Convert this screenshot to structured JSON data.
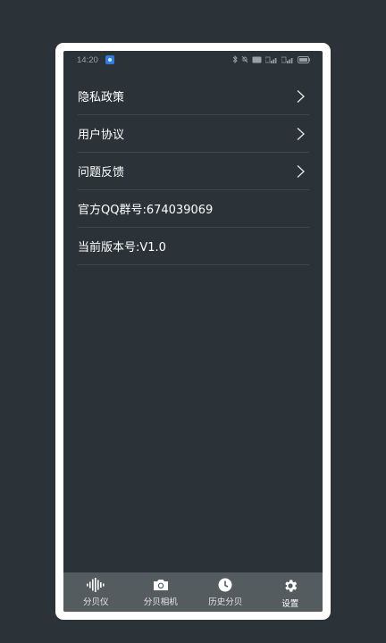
{
  "status_bar": {
    "time": "14:20"
  },
  "menu": {
    "items": [
      {
        "label": "隐私政策",
        "has_arrow": true
      },
      {
        "label": "用户协议",
        "has_arrow": true
      },
      {
        "label": "问题反馈",
        "has_arrow": true
      },
      {
        "label": "官方QQ群号:674039069",
        "has_arrow": false
      },
      {
        "label": "当前版本号:V1.0",
        "has_arrow": false
      }
    ]
  },
  "tab_bar": {
    "tabs": [
      {
        "label": "分贝仪",
        "icon": "waveform-icon"
      },
      {
        "label": "分贝相机",
        "icon": "camera-icon"
      },
      {
        "label": "历史分贝",
        "icon": "clock-icon"
      },
      {
        "label": "设置",
        "icon": "gear-icon"
      }
    ],
    "active_index": 3
  },
  "colors": {
    "background": "#2b3338",
    "frame": "#ffffff",
    "tab_bar": "#545c60",
    "divider": "#3d474c",
    "text": "#ffffff"
  }
}
